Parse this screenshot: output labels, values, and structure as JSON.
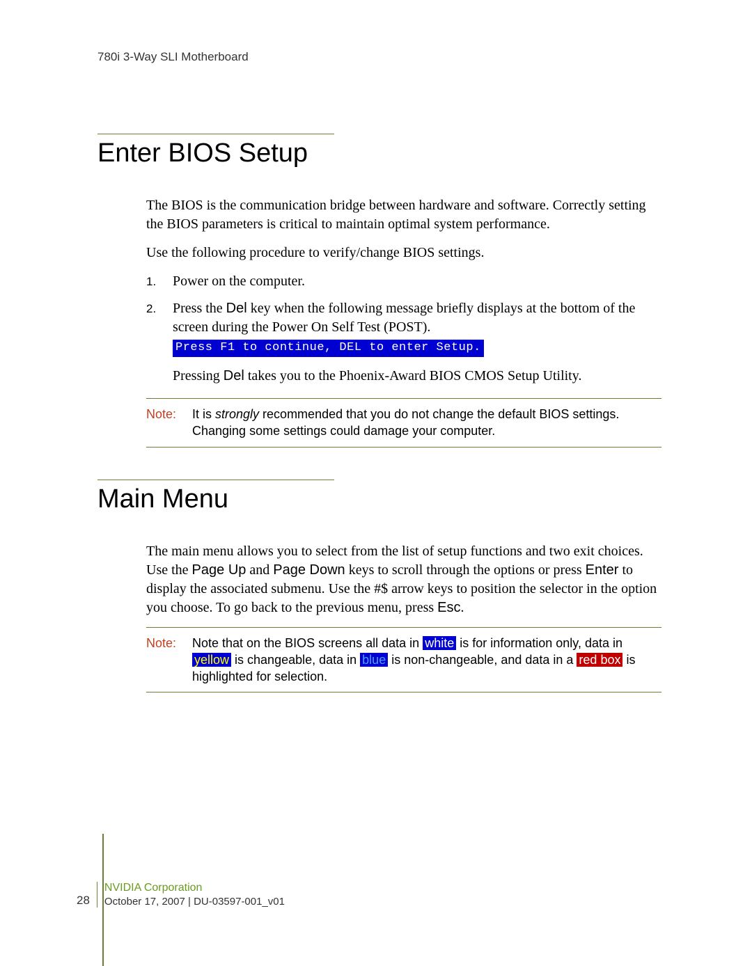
{
  "header": "780i 3-Way SLI Motherboard",
  "section1": {
    "title": "Enter BIOS Setup",
    "para1": "The BIOS is the communication bridge between hardware and software. Correctly setting the BIOS parameters is critical to maintain optimal system performance.",
    "para2": "Use the following procedure to verify/change BIOS settings.",
    "steps": {
      "num1": "1.",
      "text1": "Power on the computer.",
      "num2": "2.",
      "text2a": "Press the ",
      "text2key": "Del",
      "text2b": " key when the following message briefly displays at the bottom of the screen during the Power On Self Test (POST).",
      "code": "Press F1 to continue, DEL to enter Setup."
    },
    "substep": {
      "a": "Pressing ",
      "key": "Del",
      "b": " takes you to the Phoenix-Award BIOS CMOS Setup Utility."
    },
    "note": {
      "label": "Note:",
      "a": "It is ",
      "em": "strongly",
      "b": " recommended that you do not change the default BIOS settings. Changing some settings could damage your computer."
    }
  },
  "section2": {
    "title": "Main Menu",
    "para": {
      "a": "The main menu allows you to select from the list of setup functions and two exit choices. Use the ",
      "k1": "Page Up",
      "b": " and ",
      "k2": "Page Down",
      "c": " keys to scroll through the options or press ",
      "k3": "Enter",
      "d": " to display the associated submenu. Use the #$ arrow keys to position the selector in the option you choose. To go back to the previous menu, press ",
      "k4": "Esc",
      "e": "."
    },
    "note": {
      "label": "Note:",
      "a": "Note that on the BIOS screens all data in ",
      "white": "white",
      "b": " is for information only, data in ",
      "yellow": "yellow",
      "c": " is changeable, data in ",
      "blue": "blue",
      "d": " is non-changeable, and data in a ",
      "redbox": "red box",
      "e": " is highlighted for selection."
    }
  },
  "footer": {
    "page": "28",
    "corp": "NVIDIA Corporation",
    "date": "October 17, 2007 | DU-03597-001_v01"
  }
}
